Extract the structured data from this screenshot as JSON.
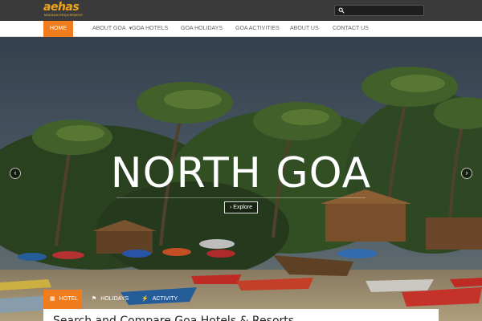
{
  "header": {
    "logo_word": "aehas",
    "logo_tagline": "MINIMUM REQUIREMENT"
  },
  "nav": {
    "items": [
      {
        "label": "HOME"
      },
      {
        "label": "ABOUT GOA"
      },
      {
        "label": "GOA HOTELS"
      },
      {
        "label": "GOA HOLIDAYS"
      },
      {
        "label": "GOA ACTIVITIES"
      },
      {
        "label": "ABOUT US"
      },
      {
        "label": "CONTACT US"
      }
    ]
  },
  "hero": {
    "title": "NORTH GOA",
    "button": "Explore"
  },
  "tabs": [
    {
      "label": "HOTEL",
      "icon": "building-icon"
    },
    {
      "label": "HOLIDAYS",
      "icon": "flag-icon"
    },
    {
      "label": "ACTIVITY",
      "icon": "bolt-icon"
    }
  ],
  "panel": {
    "title": "Search and Compare Goa Hotels & Resorts"
  },
  "colors": {
    "accent": "#f07c1e",
    "topbar": "#3a3a3a"
  }
}
